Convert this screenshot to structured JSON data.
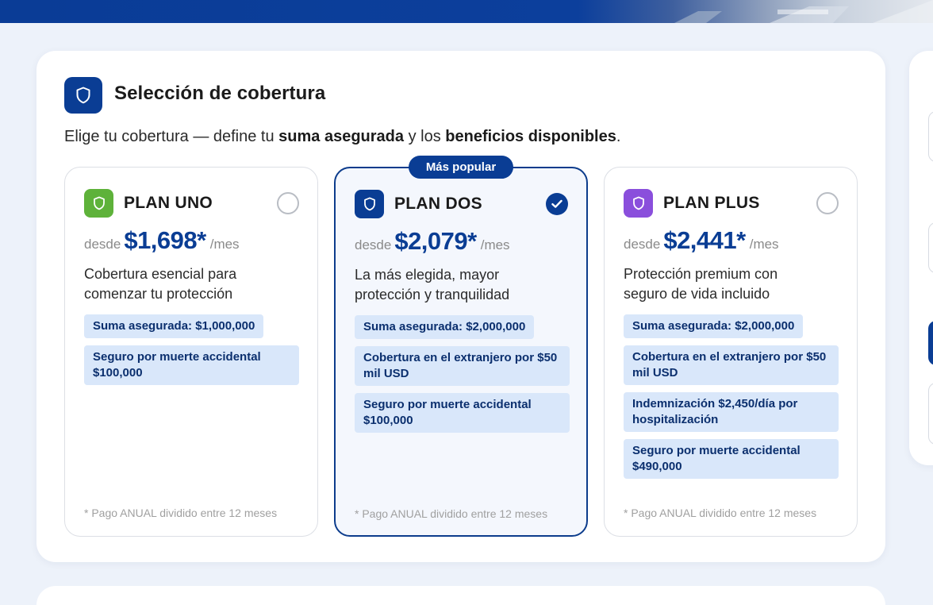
{
  "section": {
    "title": "Selección de cobertura",
    "subtitle_pre": "Elige tu cobertura — define tu ",
    "subtitle_bold1": "suma asegurada",
    "subtitle_mid": " y los ",
    "subtitle_bold2": "beneficios disponibles",
    "subtitle_post": "."
  },
  "badge": "Más popular",
  "plans": [
    {
      "name": "PLAN UNO",
      "desde": "desde",
      "price": "$1,698*",
      "per": "/mes",
      "desc_line1": "Cobertura esencial para",
      "desc_line2": "comenzar tu protección",
      "benefits": [
        "Suma asegurada: $1,000,000",
        "Seguro por muerte accidental $100,000"
      ],
      "footnote": "* Pago ANUAL dividido entre 12 meses",
      "selected": false
    },
    {
      "name": "PLAN DOS",
      "desde": "desde",
      "price": "$2,079*",
      "per": "/mes",
      "desc_line1": "La más elegida, mayor",
      "desc_line2": "protección y tranquilidad",
      "benefits": [
        "Suma asegurada: $2,000,000",
        "Cobertura en el extranjero por $50 mil USD",
        "Seguro por muerte accidental $100,000"
      ],
      "footnote": "* Pago ANUAL dividido entre 12 meses",
      "selected": true
    },
    {
      "name": "PLAN PLUS",
      "desde": "desde",
      "price": "$2,441*",
      "per": "/mes",
      "desc_line1": "Protección premium con",
      "desc_line2": "seguro de vida incluido",
      "benefits": [
        "Suma asegurada: $2,000,000",
        "Cobertura en el extranjero por $50 mil USD",
        "Indemnización $2,450/día por hospitalización",
        "Seguro por muerte accidental $490,000"
      ],
      "footnote": "* Pago ANUAL dividido entre 12 meses",
      "selected": false
    }
  ],
  "colors": {
    "primary": "#0a3d94",
    "plan_uno_icon": "#5eb23a",
    "plan_dos_icon": "#0a3d94",
    "plan_plus_icon": "#8a4fdc",
    "benefit_bg": "#d9e7fa",
    "page_bg": "#edf2fa"
  },
  "icons": {
    "header": "shield-icon",
    "plan": "shield-icon",
    "selected": "checkmark-icon"
  }
}
